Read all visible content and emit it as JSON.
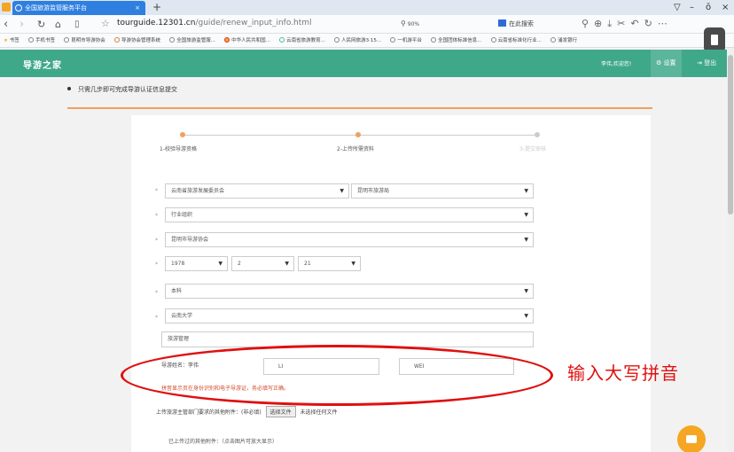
{
  "browser": {
    "tab_title": "全国旅游监管服务平台",
    "tab_close": "×",
    "new_tab": "+",
    "url_domain": "tourguide.12301.cn",
    "url_path": "/guide/renew_input_info.html",
    "zoom": "90%",
    "search_placeholder": "在此搜索",
    "window_controls": [
      "▽",
      "–",
      "ō",
      "×"
    ],
    "bookmarks": [
      "书签",
      "手机书签",
      "昆明市导游协会",
      "导游协会管理系统",
      "全国旅游监管服...",
      "中华人民共和国...",
      "云南省旅游教育...",
      "人民网旅游3·15...",
      "一机游平台",
      "全国团体标准信息...",
      "云南省标准化行业...",
      "浦发银行"
    ]
  },
  "site": {
    "logo": "导游之家",
    "welcome": "李伟,欢迎您!",
    "settings": "设置",
    "logout": "登出",
    "accent": "#3fa889"
  },
  "notice": "只需几步即可完成导游认证信息提交",
  "steps": [
    {
      "label": "1-校验导游资格",
      "state": "done"
    },
    {
      "label": "2-上传所需资料",
      "state": "active"
    },
    {
      "label": "3-提交审核",
      "state": "pending"
    }
  ],
  "form": {
    "province_org": "云南省旅游发展委员会",
    "city_bureau": "昆明市旅游局",
    "category": "行业组织",
    "association": "昆明市导游协会",
    "birth_year": "1978",
    "birth_month": "2",
    "birth_day": "21",
    "education": "本科",
    "school": "云南大学",
    "major": "旅游管理",
    "name_label": "导游姓名：李伟",
    "pinyin_surname": "LI",
    "pinyin_given": "WEI",
    "hint": "拼音显示页在身份识别和电子导游证，务必填写正确。",
    "upload_label": "上传旅游主管部门要求的其他附件：(非必填)",
    "upload_button": "选择文件",
    "upload_status": "未选择任何文件",
    "uploaded_label": "已上传过的其他附件：（点击图片可放大显示）"
  },
  "annotation": "输入大写拼音"
}
